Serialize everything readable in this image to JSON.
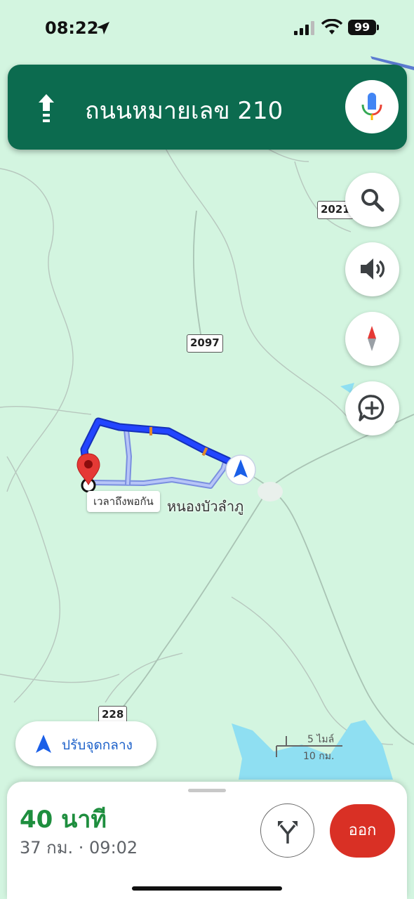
{
  "status_bar": {
    "time": "08:22",
    "battery": "99",
    "location_icon": "location-arrow-icon",
    "signal_icon": "cellular-signal-icon",
    "wifi_icon": "wifi-icon"
  },
  "navigation": {
    "direction_icon": "arrow-up-icon",
    "street": "ถนนหมายเลข 210",
    "mic_icon": "microphone-icon"
  },
  "map_controls": {
    "search_icon": "search-icon",
    "sound_icon": "speaker-icon",
    "compass_icon": "compass-icon",
    "report_icon": "add-report-icon"
  },
  "map": {
    "road_shields": [
      "2021",
      "2097",
      "228"
    ],
    "destination_label": "เวลาถึงพอกัน",
    "town_label": "หนองบัวลำภู",
    "scale_top": "5 ไมล์",
    "scale_bottom": "10 กม."
  },
  "recenter": {
    "label": "ปรับจุดกลาง",
    "icon": "navigation-arrow-icon"
  },
  "trip": {
    "eta_minutes": "40 นาที",
    "details": "37 กม. · 09:02",
    "routes_icon": "alternate-routes-icon",
    "exit_label": "ออก"
  },
  "colors": {
    "banner": "#0c6b4f",
    "map_background": "#d3f5e0",
    "route": "#1a3cff",
    "eta_green": "#1e8e3e",
    "exit_red": "#d93025"
  }
}
